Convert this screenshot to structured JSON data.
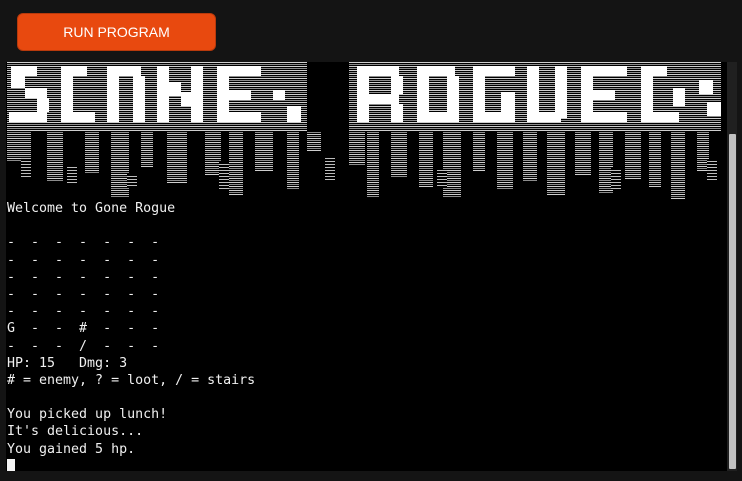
{
  "toolbar": {
    "run_label": "RUN PROGRAM",
    "accent": "#e8490f"
  },
  "terminal": {
    "background": "#000000",
    "lines": [
      "Welcome to Gone Rogue",
      "",
      "-  -  -  -  -  -  -",
      "-  -  -  -  -  -  -",
      "-  -  -  -  -  -  -",
      "-  -  -  -  -  -  -",
      "-  -  -  -  -  -  -",
      "G  -  -  #  -  -  -",
      "-  -  -  /  -  -  -",
      "HP: 15   Dmg: 3",
      "# = enemy, ? = loot, / = stairs",
      "",
      "You picked up lunch!",
      "It's delicious...",
      "You gained 5 hp."
    ]
  }
}
